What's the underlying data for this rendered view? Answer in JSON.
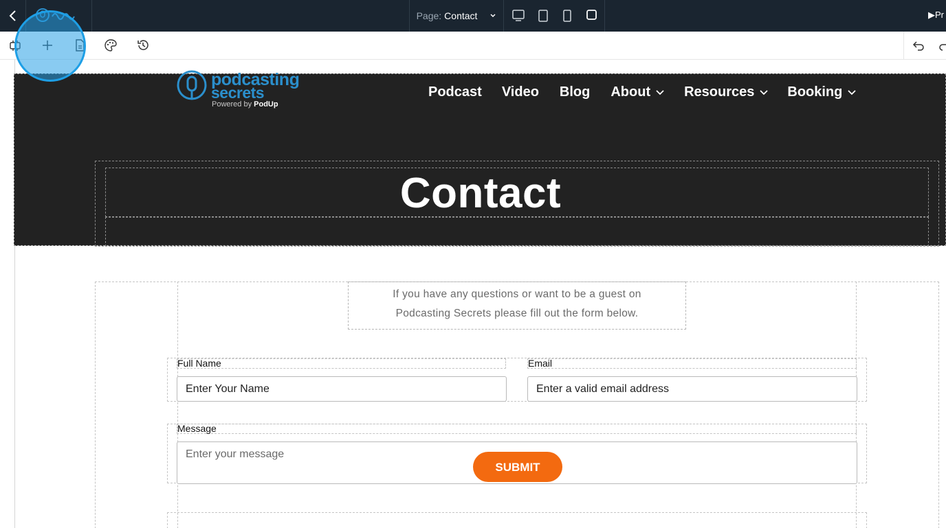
{
  "topbar": {
    "page_label": "Page:",
    "page_value": "Contact",
    "preview_label": "Pr"
  },
  "site": {
    "logo_line1": "podcasting",
    "logo_line2": "secrets",
    "logo_powered": "Powered by",
    "logo_powered_brand": "PodUp",
    "nav": [
      {
        "label": "Podcast"
      },
      {
        "label": "Video"
      },
      {
        "label": "Blog"
      },
      {
        "label": "About"
      },
      {
        "label": "Resources"
      },
      {
        "label": "Booking"
      }
    ],
    "hero_title": "Contact",
    "intro_line1": "If you have any questions or want to be a guest on",
    "intro_line2": "Podcasting Secrets please fill out the form below."
  },
  "form": {
    "full_name_label": "Full Name",
    "full_name_value": "Enter Your Name",
    "email_label": "Email",
    "email_value": "Enter a valid email address",
    "message_label": "Message",
    "message_placeholder": "Enter your message",
    "submit_label": "SUBMIT"
  },
  "colors": {
    "topbar_bg": "#1a2530",
    "hero_bg": "#222222",
    "brand_blue": "#2b8fcc",
    "submit_orange": "#f36a10",
    "cursor_highlight": "#1e9fe6"
  }
}
